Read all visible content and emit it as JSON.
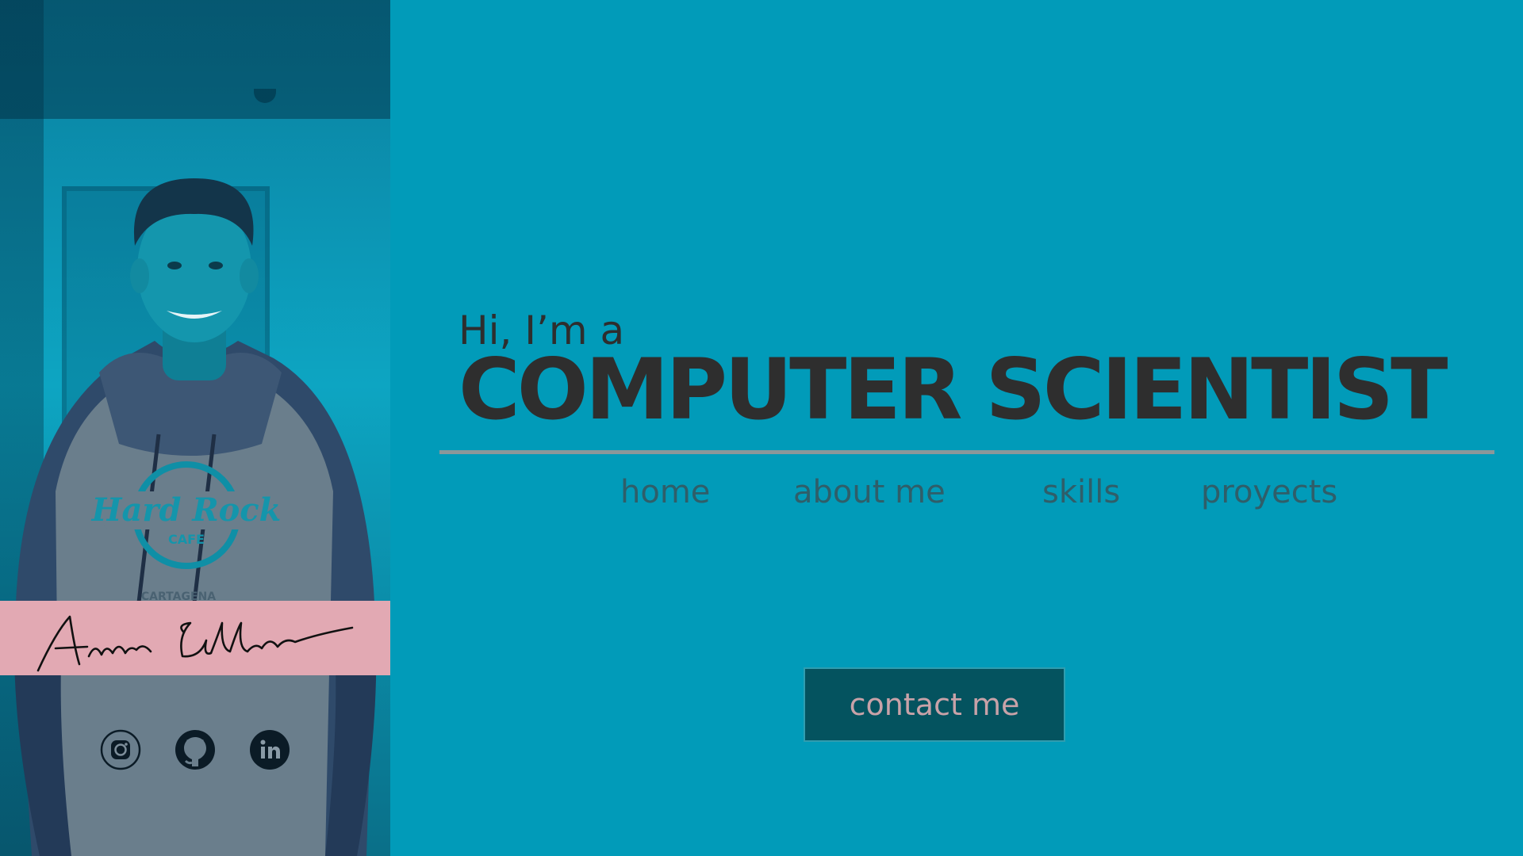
{
  "profile": {
    "signature_text": "Andres Gallego",
    "shirt_print": [
      "Hard Rock",
      "CAFE",
      "CARTAGENA"
    ]
  },
  "social": {
    "items": [
      {
        "name": "instagram",
        "icon": "instagram-icon"
      },
      {
        "name": "github",
        "icon": "github-icon"
      },
      {
        "name": "linkedin",
        "icon": "linkedin-icon"
      }
    ]
  },
  "hero": {
    "intro": "Hi, I’m a",
    "title": "COMPUTER SCIENTIST"
  },
  "nav": {
    "items": [
      {
        "label": "home"
      },
      {
        "label": "about me"
      },
      {
        "label": "skills"
      },
      {
        "label": "proyects"
      }
    ]
  },
  "contact": {
    "label": "contact me"
  },
  "colors": {
    "background": "#019bb9",
    "title_text": "#2e2e2e",
    "nav_text": "#2f5e69",
    "divider": "#8b979a",
    "signature_band": "#e2a9b3",
    "button_bg": "#04535f",
    "button_text": "#c8a2a8"
  }
}
